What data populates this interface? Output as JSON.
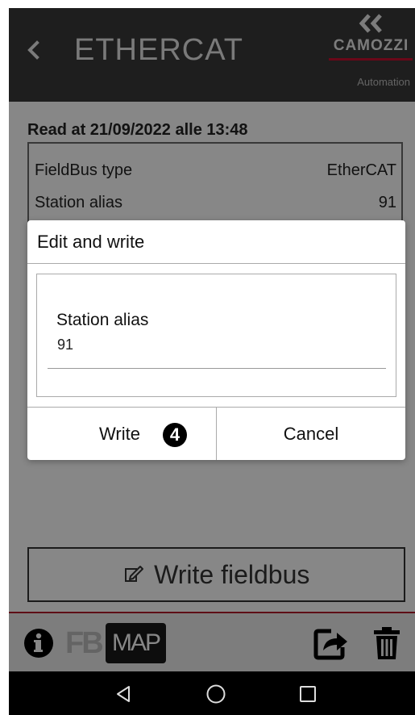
{
  "header": {
    "back_icon": "chevron-left-icon",
    "title": "ETHERCAT",
    "logo": {
      "brand": "CAMOZZI",
      "sub": "Automation",
      "accent": "#c8102e"
    }
  },
  "info": {
    "read_at": "Read at 21/09/2022 alle 13:48",
    "rows": [
      {
        "label": "FieldBus type",
        "value": "EtherCAT"
      },
      {
        "label": "Station alias",
        "value": "91"
      }
    ]
  },
  "write_button": {
    "icon": "edit-icon",
    "label": "Write fieldbus"
  },
  "bottom_bar": {
    "info_icon": "info-icon",
    "fb_label": "FB",
    "map_label": "MAP",
    "share_icon": "share-icon",
    "trash_icon": "trash-icon"
  },
  "dialog": {
    "title": "Edit and write",
    "field_label": "Station alias",
    "field_value": "91",
    "write_label": "Write",
    "badge": "4",
    "cancel_label": "Cancel"
  },
  "nav": {
    "back": "nav-back-icon",
    "home": "nav-home-icon",
    "recents": "nav-recents-icon"
  },
  "colors": {
    "header_bg": "#3a3a3a",
    "accent_red": "#b21c2a",
    "overlay": "rgba(0,0,0,0.47)"
  }
}
